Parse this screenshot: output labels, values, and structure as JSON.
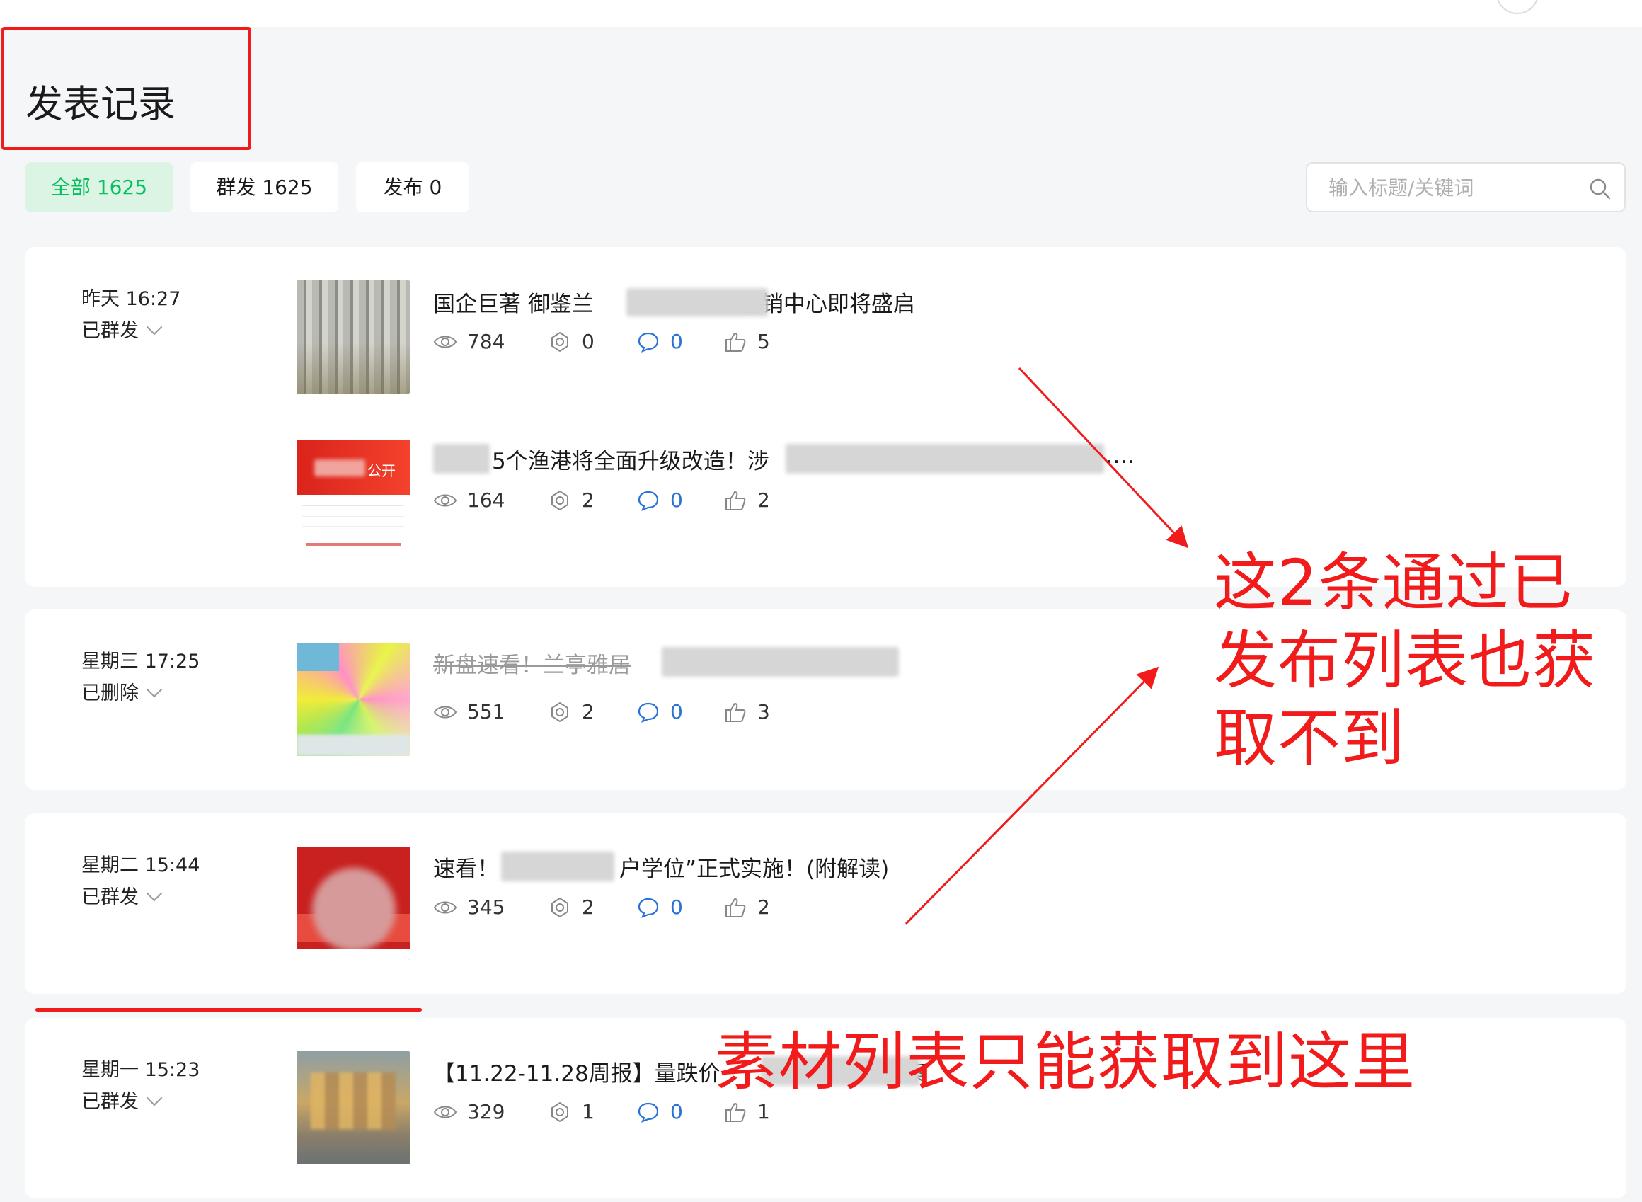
{
  "page": {
    "title": "发表记录"
  },
  "tabs": [
    {
      "label": "全部 1625",
      "active": true
    },
    {
      "label": "群发 1625",
      "active": false
    },
    {
      "label": "发布 0",
      "active": false
    }
  ],
  "search": {
    "placeholder": "输入标题/关键词",
    "icon": "search-icon"
  },
  "records": [
    {
      "time": "昨天 16:27",
      "status": "已群发",
      "articles": [
        {
          "title_prefix": "国企巨著 御鉴兰",
          "title_suffix": "营销中心即将盛启",
          "views": "784",
          "shares": "0",
          "comments": "0",
          "likes": "5"
        },
        {
          "title_prefix": "",
          "title_suffix": "5个渔港将全面升级改造！涉",
          "title_end": "….",
          "views": "164",
          "shares": "2",
          "comments": "0",
          "likes": "2",
          "thumb_text": "公开"
        }
      ]
    },
    {
      "time": "星期三 17:25",
      "status": "已删除",
      "articles": [
        {
          "title_prefix": "新盘速看！兰亭雅居",
          "title_suffix": "",
          "views": "551",
          "shares": "2",
          "comments": "0",
          "likes": "3",
          "deleted": true
        }
      ]
    },
    {
      "time": "星期二 15:44",
      "status": "已群发",
      "articles": [
        {
          "title_prefix": "速看！",
          "title_suffix": "户学位”正式实施！(附解读)",
          "views": "345",
          "shares": "2",
          "comments": "0",
          "likes": "2"
        }
      ]
    },
    {
      "time": "星期一 15:23",
      "status": "已群发",
      "articles": [
        {
          "title_prefix": "【11.22-11.28周报】量跌价",
          "title_suffix": "备案",
          "views": "329",
          "shares": "1",
          "comments": "0",
          "likes": "1"
        }
      ]
    }
  ],
  "annotations": {
    "note_1": "这2条通过已发布列表也获取不到",
    "note_2": "素材列表只能获取到这里",
    "color": "#f21b1b"
  },
  "colors": {
    "accent": "#07c160",
    "accent_bg": "#dcf4e4",
    "comment_blue": "#2a72d6",
    "page_bg": "#f5f6f7"
  }
}
